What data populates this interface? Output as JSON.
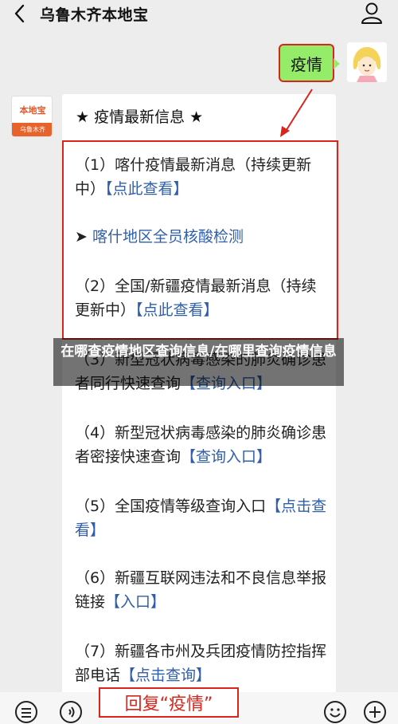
{
  "header": {
    "title": "乌鲁木齐本地宝"
  },
  "chat": {
    "my_message": "疫情",
    "bot_avatar": {
      "logo_text": "本地宝",
      "sub_text": "乌鲁木齐"
    },
    "card": {
      "title": "★ 疫情最新信息 ★",
      "items": [
        {
          "text": "（1）喀什疫情最新消息（持续更新中）",
          "link": "【点此查看】"
        },
        {
          "text": "➤ ",
          "link": "喀什地区全员核酸检测"
        },
        {
          "text": "（2）全国/新疆疫情最新消息（持续更新中）",
          "link": "【点此查看】"
        },
        {
          "text": "（3）新型冠状病毒感染的肺炎确诊患者同行快速查询",
          "link": "【查询入口】"
        },
        {
          "text": "（4）新型冠状病毒感染的肺炎确诊患者密接快速查询",
          "link": "【查询入口】"
        },
        {
          "text": "（5）全国疫情等级查询入口",
          "link": "【点击查看】"
        },
        {
          "text": "（6）新疆互联网违法和不良信息举报链接",
          "link": "【入口】"
        },
        {
          "text": "（7）新疆各市州及兵团疫情防控指挥部电话",
          "link": "【点击查询】"
        }
      ]
    }
  },
  "caption": "在哪查疫情地区查询信息/在哪里查询疫情信息",
  "bottom": {
    "reply_hint": "回复“疫情”"
  },
  "colors": {
    "accent_red": "#d9261c",
    "bubble_green": "#95ec69",
    "link_blue": "#2f5faa"
  }
}
